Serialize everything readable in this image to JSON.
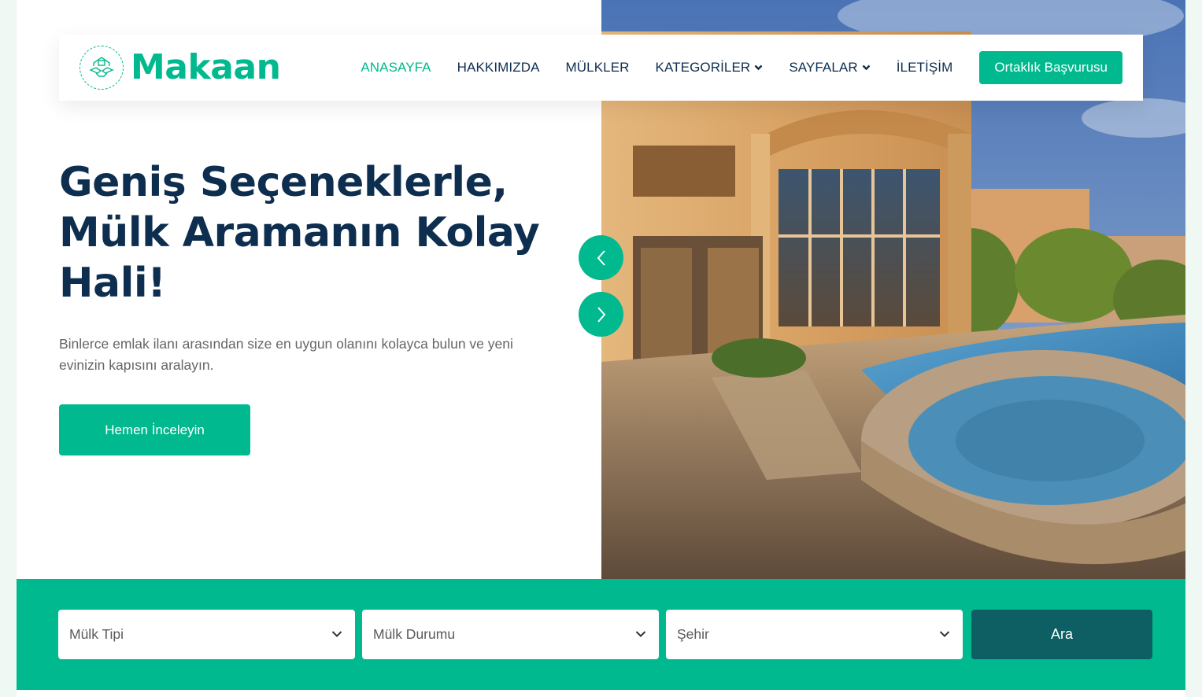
{
  "brand": {
    "name": "Makaan",
    "logo_icon": "handshake-house-icon"
  },
  "nav": {
    "items": [
      {
        "label": "ANASAYFA",
        "active": true
      },
      {
        "label": "HAKKIMIZDA",
        "active": false
      },
      {
        "label": "MÜLKLER",
        "active": false
      },
      {
        "label": "KATEGORİLER",
        "active": false,
        "dropdown": true
      },
      {
        "label": "SAYFALAR",
        "active": false,
        "dropdown": true
      },
      {
        "label": "İLETİŞİM",
        "active": false
      }
    ],
    "cta_label": "Ortaklık Başvurusu"
  },
  "hero": {
    "title_lines": [
      "Geniş Seçeneklerle,",
      "Mülk Aramanın Kolay",
      "Hali!"
    ],
    "text": "Binlerce emlak ilanı arasından size en uygun olanını kolayca bulun ve yeni evinizin kapısını aralayın.",
    "button_label": "Hemen İnceleyin",
    "image_alt": "luxury-house-with-pool-photo"
  },
  "carousel": {
    "prev_icon": "chevron-left-icon",
    "next_icon": "chevron-right-icon"
  },
  "search": {
    "property_type": "Mülk Tipi",
    "property_status": "Mülk Durumu",
    "city": "Şehir",
    "button_label": "Ara"
  },
  "colors": {
    "primary": "#00b98e",
    "dark": "#0e2e50",
    "search_button": "#0e5f63",
    "text_muted": "#666565"
  }
}
